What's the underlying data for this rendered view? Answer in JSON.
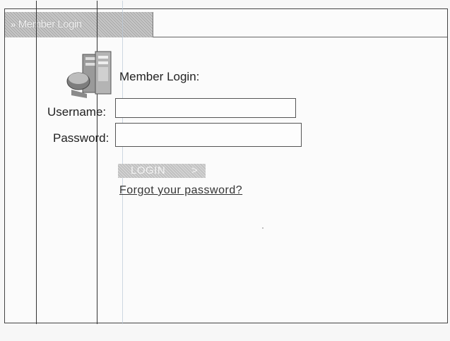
{
  "header": {
    "tab_icon": "»",
    "tab_label": "Member Login"
  },
  "login": {
    "heading": "Member Login:",
    "username_label": "Username:",
    "password_label": "Password:",
    "username_value": "",
    "password_value": "",
    "login_button_label": "LOGIN",
    "login_button_arrow": ">",
    "forgot_link": "Forgot your password?"
  },
  "icons": {
    "logo": "member-server-icon",
    "tab": "double-chevron-icon",
    "arrow": "arrow-right-icon"
  },
  "colors": {
    "tab_background": "#b8b8b8",
    "border": "#444444",
    "text": "#222222"
  }
}
